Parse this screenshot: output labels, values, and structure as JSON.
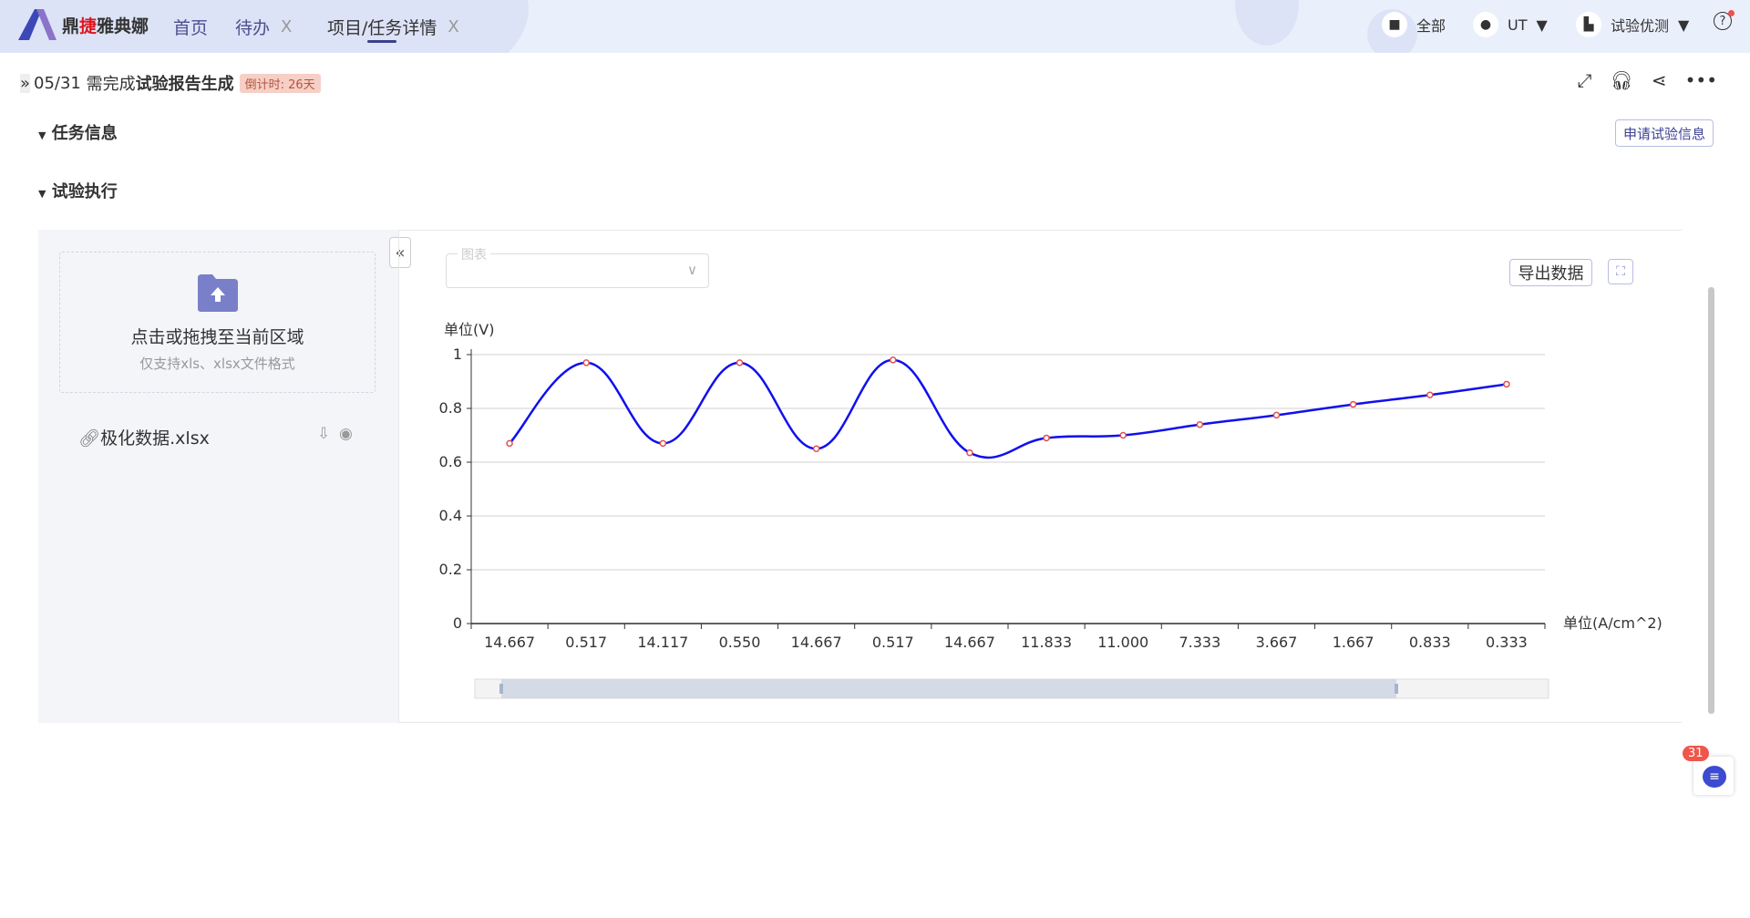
{
  "topbar": {
    "brand": {
      "pre": "鼎",
      "accent": "捷",
      "post": "雅典娜"
    },
    "tabs": [
      {
        "label": "首页",
        "closable": false
      },
      {
        "label": "待办",
        "closable": true
      },
      {
        "label": "项目/任务详情",
        "closable": true,
        "active": true
      }
    ],
    "close_glyph": "X",
    "right": {
      "all": "全部",
      "user": "UT",
      "org": "试验优测"
    }
  },
  "header": {
    "date": "05/31",
    "need": "需完成",
    "task": "试验报告生成",
    "countdown": "倒计时: 26天"
  },
  "sections": {
    "task_info": "任务信息",
    "execution": "试验执行",
    "apply_button": "申请试验信息"
  },
  "upload": {
    "title": "点击或拖拽至当前区域",
    "hint": "仅支持xls、xlsx文件格式",
    "file": "极化数据.xlsx"
  },
  "chart_panel": {
    "select_label": "图表",
    "select_value": "",
    "export": "导出数据"
  },
  "chat_badge": "31",
  "colors": {
    "accent": "#3d3f87",
    "line": "#1010ee",
    "marker": "#e05050",
    "badge": "#f6cfc6"
  },
  "chart_data": {
    "type": "line",
    "ylabel": "单位(V)",
    "xlabel": "单位(A/cm^2)",
    "categories": [
      "14.667",
      "0.517",
      "14.117",
      "0.550",
      "14.667",
      "0.517",
      "14.667",
      "11.833",
      "11.000",
      "7.333",
      "3.667",
      "1.667",
      "0.833",
      "0.333"
    ],
    "values": [
      0.67,
      0.97,
      0.67,
      0.97,
      0.65,
      0.98,
      0.635,
      0.69,
      0.7,
      0.74,
      0.775,
      0.815,
      0.85,
      0.89
    ],
    "ylim": [
      0,
      1
    ],
    "yticks": [
      "0",
      "0.2",
      "0.4",
      "0.6",
      "0.8",
      "1"
    ],
    "grid": true,
    "smooth": true,
    "datazoom": true
  }
}
